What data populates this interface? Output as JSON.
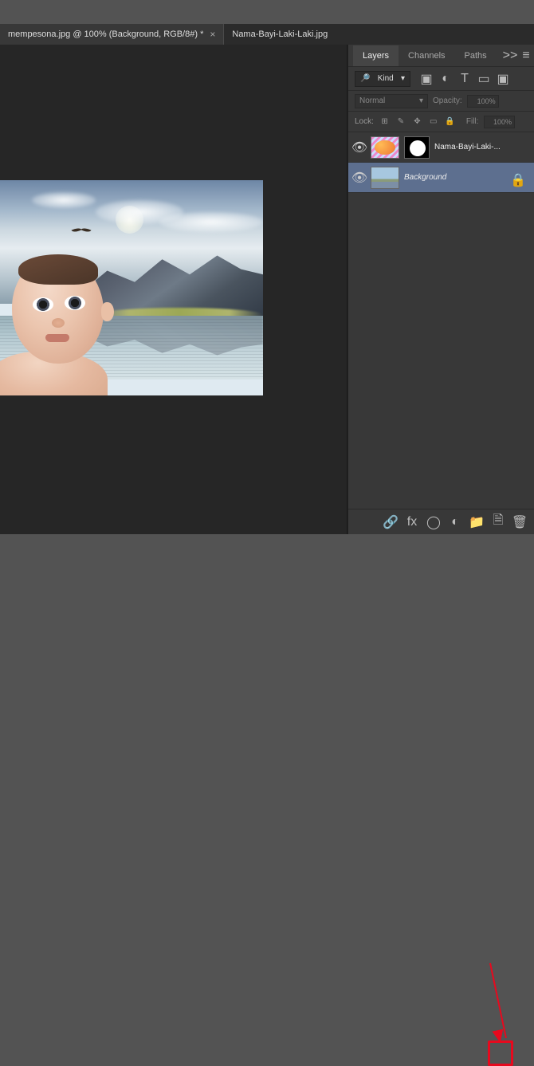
{
  "top": {
    "label": ""
  },
  "tabs": [
    {
      "title": "mempesona.jpg @ 100% (Background, RGB/8#) *",
      "active": true
    },
    {
      "title": "Nama-Bayi-Laki-Laki.jpg",
      "active": false
    }
  ],
  "panel": {
    "tabs": {
      "layers": "Layers",
      "channels": "Channels",
      "paths": "Paths"
    },
    "chevrons": ">>"
  },
  "filter": {
    "label": "Kind",
    "icons": [
      "image",
      "adjust",
      "type",
      "shape",
      "smart"
    ]
  },
  "blend": {
    "mode": "Normal",
    "opacity_label": "Opacity:",
    "opacity_value": "100%"
  },
  "lock": {
    "label": "Lock:",
    "fill_label": "Fill:",
    "fill_value": "100%"
  },
  "layers": [
    {
      "name": "Nama-Bayi-Laki-...",
      "selected": false,
      "masked": true,
      "locked": false
    },
    {
      "name": "Background",
      "selected": true,
      "masked": false,
      "locked": true
    }
  ],
  "bottom_icons": [
    "link",
    "fx",
    "mask",
    "adjustment",
    "group",
    "new",
    "trash"
  ],
  "glyphs": {
    "close": "×",
    "search": "🔎",
    "chevron": "▾",
    "menu": "≡",
    "eye": "👁",
    "lock": "🔒",
    "link": "🔗",
    "mask": "◯",
    "adjust": "◐",
    "folder": "📁",
    "new": "🗎",
    "trash": "🗑",
    "image_filter": "▣",
    "circle_half": "◐",
    "type": "T",
    "shape": "▭",
    "smart": "▣",
    "grid": "⊞",
    "move": "✥",
    "brush": "✎",
    "fx": "fx"
  }
}
